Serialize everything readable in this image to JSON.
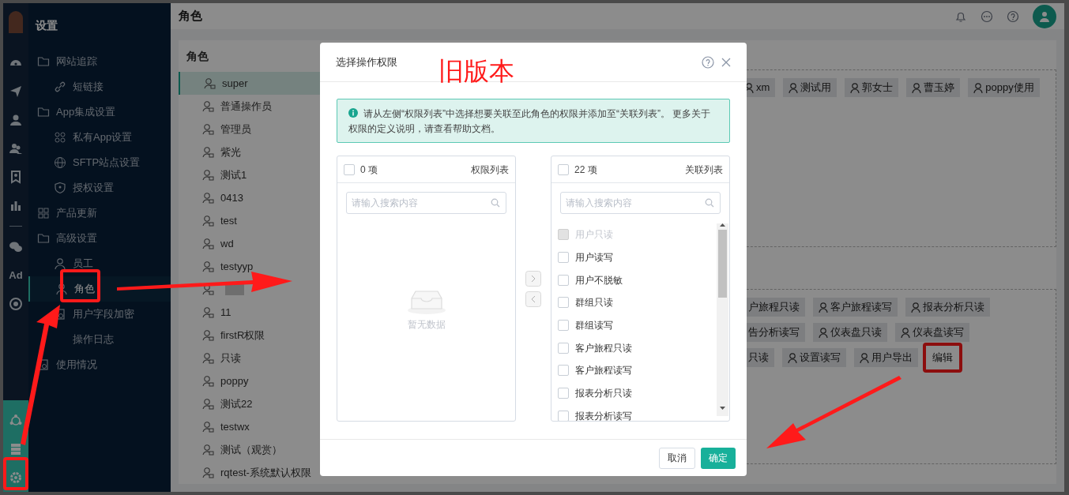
{
  "sidebar": {
    "title": "设置",
    "rail_label": "Ad",
    "items": [
      {
        "label": "网站追踪",
        "selected": false,
        "children": [
          {
            "label": "短链接",
            "selected": false
          }
        ]
      },
      {
        "label": "App集成设置",
        "selected": false,
        "children": [
          {
            "label": "私有App设置",
            "selected": false
          },
          {
            "label": "SFTP站点设置",
            "selected": false
          },
          {
            "label": "授权设置",
            "selected": false
          }
        ]
      },
      {
        "label": "产品更新",
        "selected": false
      },
      {
        "label": "高级设置",
        "selected": false,
        "children": [
          {
            "label": "员工",
            "selected": false
          },
          {
            "label": "角色",
            "selected": true
          },
          {
            "label": "用户字段加密",
            "selected": false
          },
          {
            "label": "操作日志",
            "selected": false
          }
        ]
      },
      {
        "label": "使用情况",
        "selected": false
      }
    ]
  },
  "header": {
    "title": "角色"
  },
  "roles": {
    "title": "角色",
    "items": [
      {
        "label": "super",
        "selected": true
      },
      {
        "label": "普通操作员",
        "selected": false
      },
      {
        "label": "管理员",
        "selected": false
      },
      {
        "label": "紫光",
        "selected": false
      },
      {
        "label": "测试1",
        "selected": false
      },
      {
        "label": "0413",
        "selected": false
      },
      {
        "label": "test",
        "selected": false
      },
      {
        "label": "wd",
        "selected": false
      },
      {
        "label": "testyyp",
        "selected": false
      },
      {
        "kind": "redacted",
        "selected": false
      },
      {
        "label": "11",
        "selected": false
      },
      {
        "label": "firstR权限",
        "selected": false
      },
      {
        "label": "只读",
        "selected": false
      },
      {
        "label": "poppy",
        "selected": false
      },
      {
        "label": "测试22",
        "selected": false
      },
      {
        "label": "testwx",
        "selected": false
      },
      {
        "label": "测试（观赏）",
        "selected": false
      },
      {
        "label": "rqtest-系统默认权限",
        "selected": false
      }
    ]
  },
  "members": [
    {
      "label": "xm"
    },
    {
      "label": "测试用"
    },
    {
      "label": "郭女士"
    },
    {
      "label": "曹玉婷"
    },
    {
      "label": "poppy使用"
    }
  ],
  "permission_rows": [
    [
      {
        "label": "户旅程只读"
      },
      {
        "label": "客户旅程读写"
      },
      {
        "label": "报表分析只读"
      }
    ],
    [
      {
        "label": "告分析读写"
      },
      {
        "label": "仪表盘只读"
      },
      {
        "label": "仪表盘读写"
      }
    ],
    [
      {
        "label": "只读"
      },
      {
        "label": "设置读写"
      },
      {
        "label": "用户导出"
      },
      {
        "label": "编辑",
        "kind": "link"
      }
    ]
  ],
  "modal": {
    "title": "选择操作权限",
    "notice": "请从左侧“权限列表”中选择想要关联至此角色的权限并添加至“关联列表”。 更多关于权限的定义说明，请查看帮助文档。",
    "left": {
      "count": "0 项",
      "title": "权限列表",
      "checked": false,
      "placeholder": "请输入搜索内容",
      "empty": "暂无数据"
    },
    "right": {
      "count": "22 项",
      "title": "关联列表",
      "checked": false,
      "placeholder": "请输入搜索内容",
      "items": [
        {
          "label": "用户只读",
          "checked": false,
          "disabled": true
        },
        {
          "label": "用户读写",
          "checked": false,
          "disabled": false
        },
        {
          "label": "用户不脱敏",
          "checked": false,
          "disabled": false
        },
        {
          "label": "群组只读",
          "checked": false,
          "disabled": false
        },
        {
          "label": "群组读写",
          "checked": false,
          "disabled": false
        },
        {
          "label": "客户旅程只读",
          "checked": false,
          "disabled": false
        },
        {
          "label": "客户旅程读写",
          "checked": false,
          "disabled": false
        },
        {
          "label": "报表分析只读",
          "checked": false,
          "disabled": false
        },
        {
          "label": "报表分析读写",
          "checked": false,
          "disabled": false
        }
      ]
    },
    "cancel": "取消",
    "ok": "确定"
  },
  "annotation": {
    "label": "旧版本"
  }
}
